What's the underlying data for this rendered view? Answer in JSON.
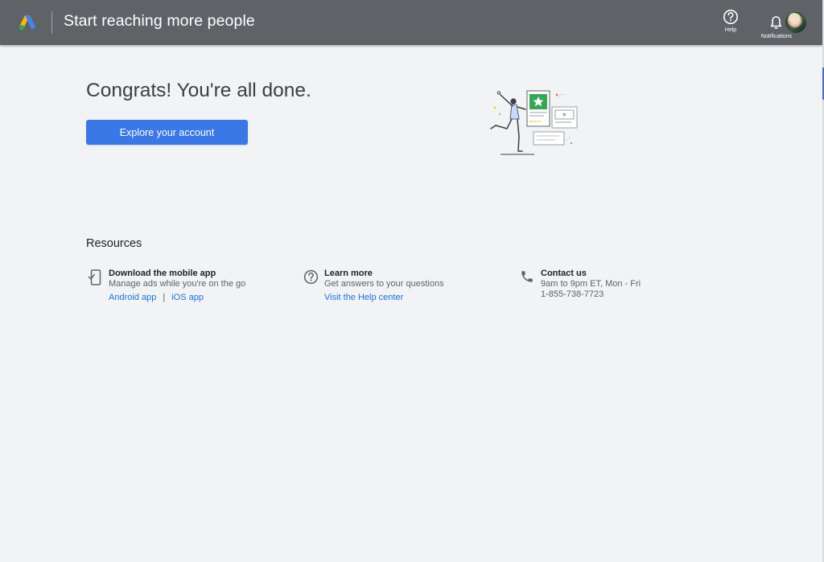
{
  "header": {
    "title": "Start reaching more people",
    "help_label": "Help",
    "notifications_label": "Notifications"
  },
  "main": {
    "heading": "Congrats! You're all done.",
    "cta_label": "Explore your account"
  },
  "resources": {
    "title": "Resources",
    "items": [
      {
        "icon": "mobile-phone-icon",
        "title": "Download the mobile app",
        "description": "Manage ads while you're on the go",
        "links": [
          "Android app",
          "iOS app"
        ],
        "link_separator": "|"
      },
      {
        "icon": "help-circle-icon",
        "title": "Learn more",
        "description": "Get answers to your questions",
        "links": [
          "Visit the Help center"
        ]
      },
      {
        "icon": "phone-icon",
        "title": "Contact us",
        "description": "9am to 9pm ET, Mon - Fri",
        "phone": "1-855-738-7723"
      }
    ]
  },
  "colors": {
    "header_bg": "#5f6368",
    "page_bg": "#f1f3f4",
    "primary_button": "#3b78e7",
    "link": "#1a73e8"
  }
}
